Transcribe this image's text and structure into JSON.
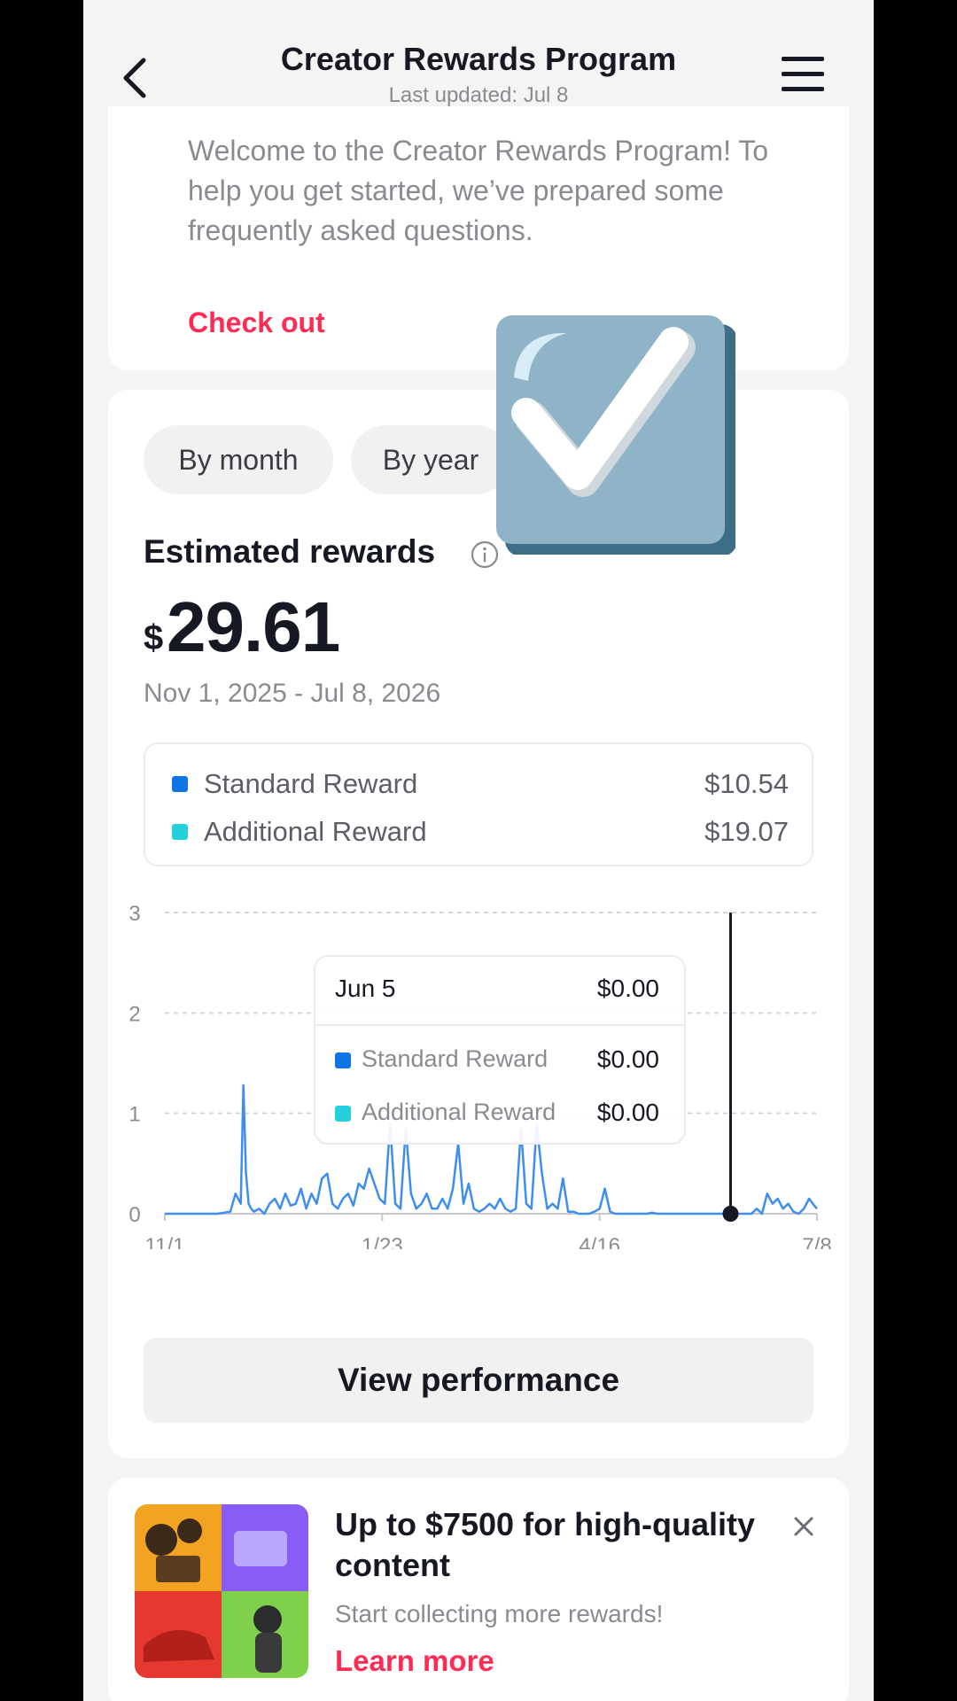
{
  "header": {
    "title": "Creator Rewards Program",
    "subtitle": "Last updated: Jul 8"
  },
  "welcome": {
    "text": "Welcome to the Creator Rewards Program! To help you get started, we’ve prepared some frequently asked questions.",
    "link": "Check out"
  },
  "filters": {
    "month": "By month",
    "year": "By year"
  },
  "rewards": {
    "label": "Estimated rewards",
    "currency": "$",
    "amount": "29.61",
    "date_range": "Nov 1, 2025 - Jul 8, 2026",
    "legend": [
      {
        "label": "Standard Reward",
        "value": "$10.54",
        "color": "#0f74e6"
      },
      {
        "label": "Additional Reward",
        "value": "$19.07",
        "color": "#25d0dd"
      }
    ]
  },
  "tooltip": {
    "date": "Jun 5",
    "total": "$0.00",
    "rows": [
      {
        "label": "Standard Reward",
        "value": "$0.00",
        "color": "#0f74e6"
      },
      {
        "label": "Additional Reward",
        "value": "$0.00",
        "color": "#25d0dd"
      }
    ]
  },
  "view_button": "View performance",
  "promo": {
    "title": "Up to $7500 for high-quality content",
    "subtitle": "Start collecting more rewards!",
    "link": "Learn more"
  },
  "chart_data": {
    "type": "line",
    "xlabel": "",
    "ylabel": "",
    "ylim": [
      0,
      3
    ],
    "yticks": [
      "0",
      "1",
      "2",
      "3"
    ],
    "xticks": [
      {
        "label": "11/1",
        "day": 0
      },
      {
        "label": "1/23",
        "day": 83
      },
      {
        "label": "4/16",
        "day": 166
      },
      {
        "label": "7/8",
        "day": 249
      }
    ],
    "grid": true,
    "series": [
      {
        "name": "Estimated rewards",
        "color": "#3d8ef0",
        "x": [
          0,
          10,
          20,
          25,
          27,
          29,
          30,
          31,
          32,
          33,
          34,
          36,
          38,
          40,
          42,
          44,
          46,
          48,
          50,
          52,
          54,
          56,
          58,
          60,
          62,
          64,
          66,
          68,
          70,
          72,
          74,
          76,
          78,
          80,
          82,
          84,
          86,
          88,
          90,
          92,
          94,
          96,
          98,
          100,
          102,
          104,
          106,
          108,
          110,
          112,
          114,
          116,
          118,
          120,
          122,
          124,
          126,
          128,
          130,
          132,
          134,
          136,
          138,
          140,
          142,
          144,
          146,
          148,
          150,
          152,
          154,
          156,
          158,
          160,
          162,
          164,
          166,
          168,
          170,
          172,
          174,
          176,
          178,
          180,
          182,
          184,
          186,
          188,
          190,
          192,
          194,
          196,
          198,
          200,
          202,
          204,
          206,
          208,
          210,
          212,
          214,
          216,
          218,
          220,
          222,
          224,
          226,
          228,
          230,
          232,
          234,
          236,
          238,
          240,
          242,
          244,
          246,
          248,
          249
        ],
        "y": [
          0,
          0,
          0,
          0.02,
          0.2,
          0.1,
          1.28,
          0.4,
          0.1,
          0.05,
          0.02,
          0.05,
          0,
          0.1,
          0.15,
          0.05,
          0.2,
          0.08,
          0.1,
          0.25,
          0.05,
          0.2,
          0.1,
          0.35,
          0.4,
          0.1,
          0.05,
          0.15,
          0.2,
          0.08,
          0.3,
          0.25,
          0.45,
          0.3,
          0.15,
          0.1,
          0.9,
          0.1,
          0.05,
          0.85,
          0.2,
          0.05,
          0.1,
          0.2,
          0.05,
          0.05,
          0.15,
          0.05,
          0.25,
          0.7,
          0.1,
          0.3,
          0.05,
          0.02,
          0.05,
          0.1,
          0.05,
          0.15,
          0.05,
          0.02,
          0.05,
          0.85,
          0.1,
          0.05,
          0.9,
          0.4,
          0.05,
          0.1,
          0.05,
          0.35,
          0.02,
          0.02,
          0,
          0,
          0,
          0.02,
          0.05,
          0.25,
          0.02,
          0,
          0,
          0,
          0,
          0,
          0,
          0,
          0.01,
          0,
          0,
          0,
          0,
          0,
          0,
          0,
          0,
          0,
          0,
          0,
          0,
          0,
          0,
          0,
          0,
          0,
          0,
          0,
          0.05,
          0,
          0.2,
          0.1,
          0.15,
          0.05,
          0.1,
          0.02,
          0,
          0.05,
          0.15,
          0.08,
          0.05
        ],
        "marker": {
          "x": 216,
          "y": 0
        }
      }
    ]
  }
}
